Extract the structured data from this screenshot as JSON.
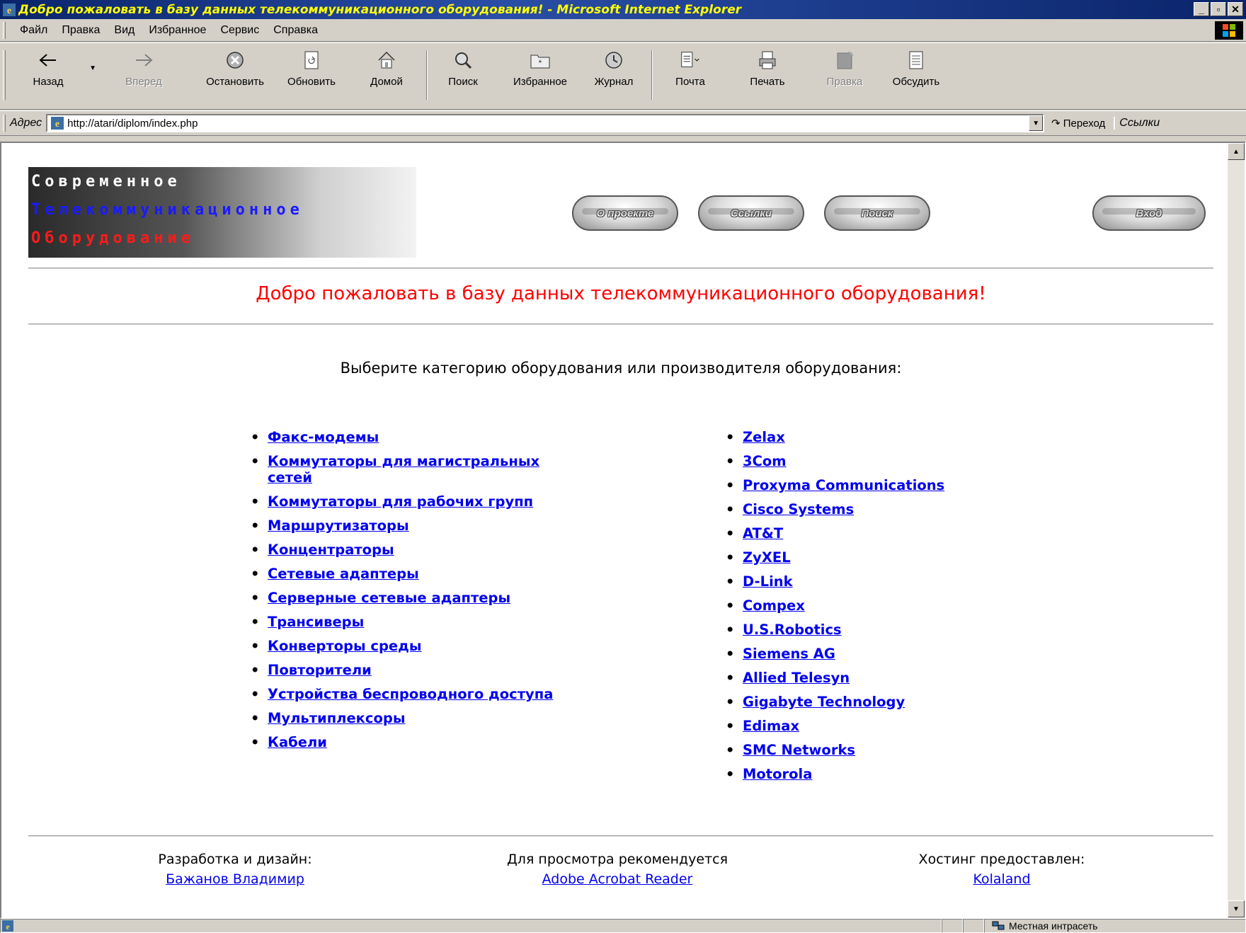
{
  "window": {
    "title": "Добро пожаловать в базу данных телекоммуникационного оборудования! - Microsoft Internet Explorer",
    "buttons": [
      "_",
      "▫",
      "✕"
    ]
  },
  "menubar": {
    "items": [
      {
        "label": "Файл"
      },
      {
        "label": "Правка"
      },
      {
        "label": "Вид"
      },
      {
        "label": "Избранное"
      },
      {
        "label": "Сервис"
      },
      {
        "label": "Справка"
      }
    ]
  },
  "toolbar": {
    "back": "Назад",
    "forward": "Вперед",
    "stop": "Остановить",
    "refresh": "Обновить",
    "home": "Домой",
    "search": "Поиск",
    "favorites": "Избранное",
    "history": "Журнал",
    "mail": "Почта",
    "print": "Печать",
    "edit": "Правка",
    "discuss": "Обсудить"
  },
  "addressbar": {
    "label": "Адрес",
    "url": "http://atari/diplom/index.php",
    "go": "Переход",
    "links": "Ссылки"
  },
  "page": {
    "banner": {
      "line1": "Современное",
      "line2": "Телекоммуникационное",
      "line3": "Оборудование"
    },
    "nav": {
      "about": "О проекте",
      "links": "Ссылки",
      "search": "Поиск",
      "login": "Вход"
    },
    "welcome": "Добро пожаловать в базу данных телекоммуникационного оборудования!",
    "prompt": "Выберите категорию оборудования или производителя оборудования:",
    "categories": [
      "Факс-модемы",
      "Коммутаторы для магистральных сетей",
      "Коммутаторы для рабочих групп",
      "Маршрутизаторы",
      "Концентраторы",
      "Сетевые адаптеры",
      "Серверные сетевые адаптеры",
      "Трансиверы",
      "Конверторы среды",
      "Повторители",
      "Устройства беспроводного доступа",
      "Мультиплексоры",
      "Кабели"
    ],
    "manufacturers": [
      "Zelax",
      "3Com",
      "Proxyma Communications",
      "Cisco Systems",
      "AT&T",
      "ZyXEL",
      "D-Link",
      "Compex",
      "U.S.Robotics",
      "Siemens AG",
      "Allied Telesyn",
      "Gigabyte Technology",
      "Edimax",
      "SMC Networks",
      "Motorola"
    ],
    "footer": {
      "dev_label": "Разработка и дизайн:",
      "dev_link": "Бажанов Владимир",
      "view_label": "Для просмотра рекомендуется",
      "view_link": "Adobe Acrobat Reader",
      "host_label": "Хостинг предоставлен:",
      "host_link": "Kolaland"
    }
  },
  "statusbar": {
    "zone": "Местная интрасеть"
  },
  "colors": {
    "title_text": "#ffff00",
    "welcome_text": "#ff0000",
    "link": "#0000ee",
    "banner_line2": "#1a1aff",
    "banner_line3": "#ff1a1a"
  }
}
